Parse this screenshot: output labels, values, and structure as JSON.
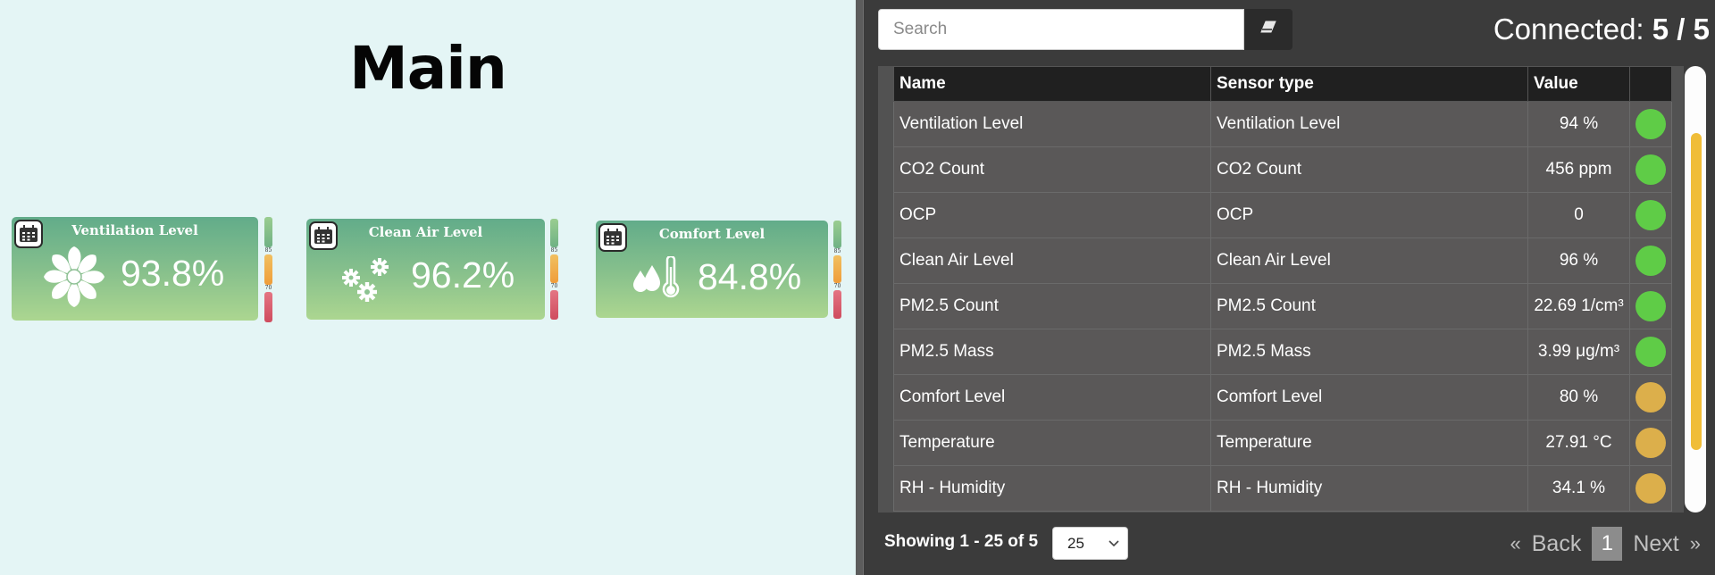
{
  "dashboard": {
    "title": "Main",
    "cards": [
      {
        "title": "Ventilation Level",
        "value": "93.8%",
        "icon": "fan-icon",
        "gauge_high": "85",
        "gauge_low": "70"
      },
      {
        "title": "Clean Air Level",
        "value": "96.2%",
        "icon": "gears-icon",
        "gauge_high": "85",
        "gauge_low": "70"
      },
      {
        "title": "Comfort Level",
        "value": "84.8%",
        "icon": "drops-thermometer-icon",
        "gauge_high": "85",
        "gauge_low": "70"
      }
    ]
  },
  "search": {
    "placeholder": "Search",
    "value": ""
  },
  "connection": {
    "label": "Connected:",
    "value": "5 / 5"
  },
  "table": {
    "headers": [
      "Name",
      "Sensor type",
      "Value",
      ""
    ],
    "rows": [
      {
        "name": "Ventilation Level",
        "type": "Ventilation Level",
        "value": "94 %",
        "status": "green"
      },
      {
        "name": "CO2 Count",
        "type": "CO2 Count",
        "value": "456 ppm",
        "status": "green"
      },
      {
        "name": "OCP",
        "type": "OCP",
        "value": "0",
        "status": "green"
      },
      {
        "name": "Clean Air Level",
        "type": "Clean Air Level",
        "value": "96 %",
        "status": "green"
      },
      {
        "name": "PM2.5 Count",
        "type": "PM2.5 Count",
        "value": "22.69 1/cm³",
        "status": "green"
      },
      {
        "name": "PM2.5 Mass",
        "type": "PM2.5 Mass",
        "value": "3.99 μg/m³",
        "status": "green"
      },
      {
        "name": "Comfort Level",
        "type": "Comfort Level",
        "value": "80 %",
        "status": "yellow"
      },
      {
        "name": "Temperature",
        "type": "Temperature",
        "value": "27.91 °C",
        "status": "yellow"
      },
      {
        "name": "RH - Humidity",
        "type": "RH - Humidity",
        "value": "34.1 %",
        "status": "yellow"
      }
    ]
  },
  "status_colors": {
    "green": "#5fcc47",
    "yellow": "#dcaf4b"
  },
  "footer": {
    "showing": "Showing 1 - 25 of 5",
    "page_size": "25",
    "pager": {
      "first": "«",
      "back": "Back",
      "current": "1",
      "next": "Next",
      "last": "»"
    }
  }
}
